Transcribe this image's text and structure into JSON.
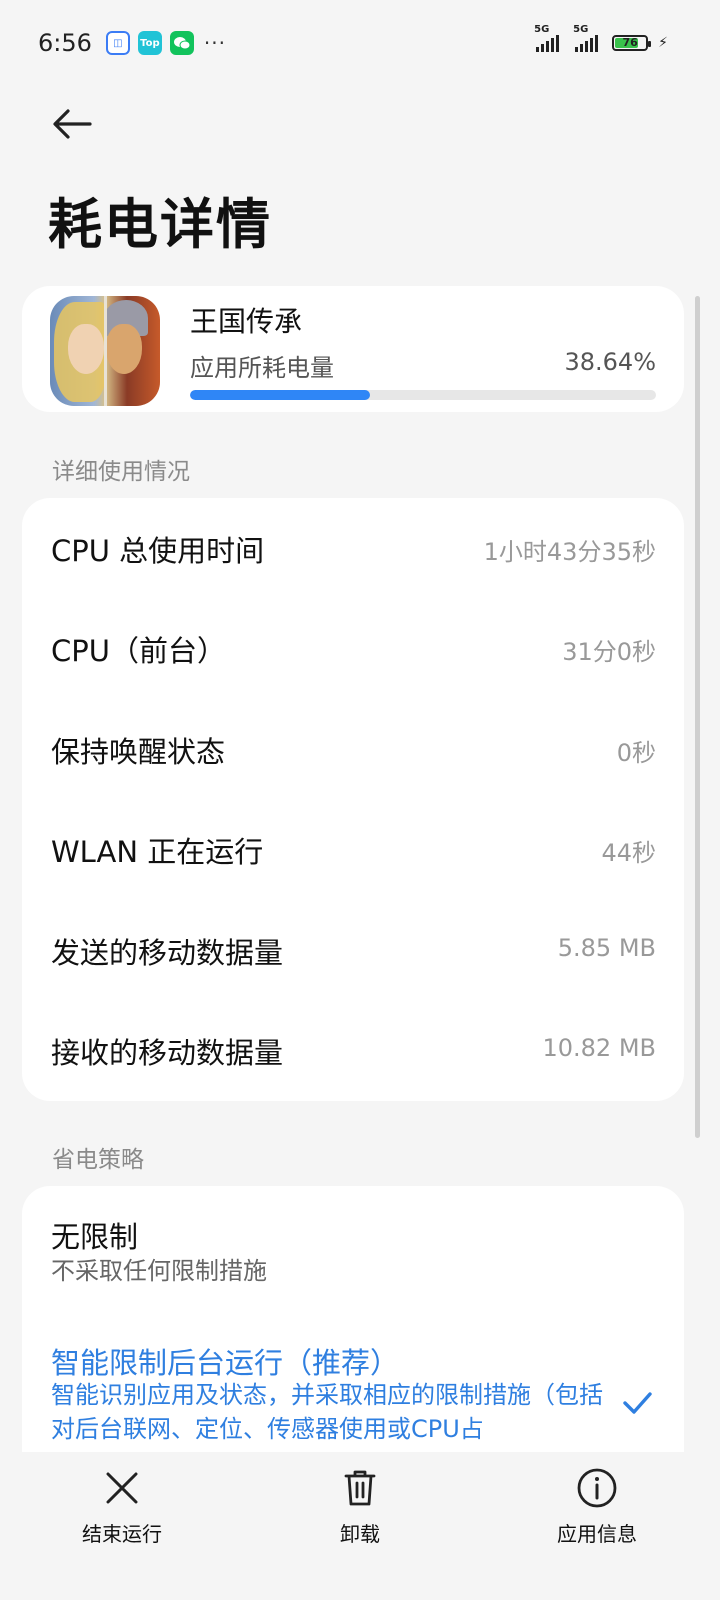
{
  "status_bar": {
    "time": "6:56",
    "notifications": [
      "app-icon-blue",
      "Top",
      "wechat-icon"
    ],
    "more": "···",
    "signal_1_label": "5G",
    "signal_2_label": "5G",
    "battery_level": "76"
  },
  "header": {
    "title": "耗电详情"
  },
  "app": {
    "name": "王国传承",
    "usage_label": "应用所耗电量",
    "usage_percent_text": "38.64%",
    "usage_fraction": 0.3864
  },
  "details": {
    "section_title": "详细使用情况",
    "rows": [
      {
        "label": "CPU 总使用时间",
        "value": "1小时43分35秒"
      },
      {
        "label": "CPU（前台）",
        "value": "31分0秒"
      },
      {
        "label": "保持唤醒状态",
        "value": "0秒"
      },
      {
        "label": "WLAN 正在运行",
        "value": "44秒"
      },
      {
        "label": "发送的移动数据量",
        "value": "5.85 MB"
      },
      {
        "label": "接收的移动数据量",
        "value": "10.82 MB"
      }
    ]
  },
  "strategy": {
    "section_title": "省电策略",
    "options": [
      {
        "title": "无限制",
        "desc": "不采取任何限制措施",
        "selected": false
      },
      {
        "title": "智能限制后台运行（推荐）",
        "desc": "智能识别应用及状态，并采取相应的限制措施（包括对后台联网、定位、传感器使用或CPU占",
        "selected": true
      }
    ]
  },
  "toolbar": {
    "end_label": "结束运行",
    "uninstall_label": "卸载",
    "info_label": "应用信息"
  },
  "colors": {
    "accent": "#2f86f6",
    "selected_text": "#2f7fe0",
    "battery_fill": "#39c24b"
  }
}
